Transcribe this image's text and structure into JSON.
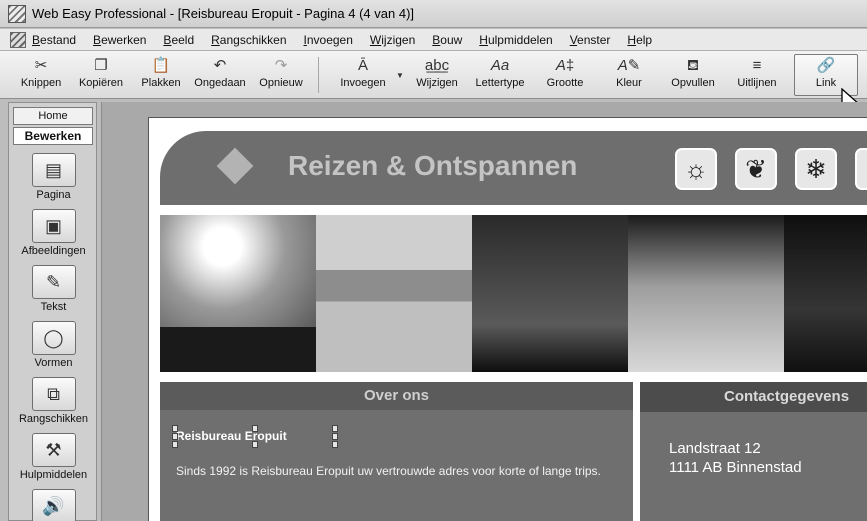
{
  "window": {
    "title": "Web Easy Professional - [Reisbureau Eropuit - Pagina 4 (4 van 4)]"
  },
  "menu": [
    "Bestand",
    "Bewerken",
    "Beeld",
    "Rangschikken",
    "Invoegen",
    "Wijzigen",
    "Bouw",
    "Hulpmiddelen",
    "Venster",
    "Help"
  ],
  "toolbar": {
    "knippen": "Knippen",
    "kopieren": "Kopiëren",
    "plakken": "Plakken",
    "ongedaan": "Ongedaan",
    "opnieuw": "Opnieuw",
    "invoegen": "Invoegen",
    "wijzigen": "Wijzigen",
    "lettertype": "Lettertype",
    "grootte": "Grootte",
    "kleur": "Kleur",
    "opvullen": "Opvullen",
    "uitlijnen": "Uitlijnen",
    "link": "Link"
  },
  "sidebar": {
    "home_tab": "Home",
    "edit_tab": "Bewerken",
    "items": [
      "Pagina",
      "Afbeeldingen",
      "Tekst",
      "Vormen",
      "Rangschikken",
      "Hulpmiddelen"
    ]
  },
  "site": {
    "title": "Reizen & Ontspannen",
    "about_heading": "Over ons",
    "company": "Reisbureau Eropuit",
    "about_text": "Sinds 1992 is Reisbureau Eropuit uw vertrouwde adres voor korte of lange trips.",
    "contact_heading": "Contactgegevens",
    "address_line1": "Landstraat 12",
    "address_line2": "1111 AB Binnenstad"
  },
  "icons": {
    "season_buttons": [
      "sun-icon",
      "maple-leaf-icon",
      "snowflake-icon",
      "flower-icon"
    ]
  }
}
